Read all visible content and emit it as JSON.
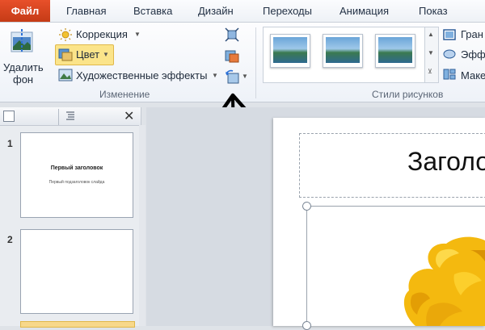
{
  "ribbon_tabs": {
    "file": "Файл",
    "home": "Главная",
    "insert": "Вставка",
    "design": "Дизайн",
    "transitions": "Переходы",
    "animation": "Анимация",
    "slideshow": "Показ слайдо"
  },
  "adjust_group": {
    "remove_bg_line1": "Удалить",
    "remove_bg_line2": "фон",
    "corrections": "Коррекция",
    "color": "Цвет",
    "artistic_effects": "Художественные эффекты",
    "label": "Изменение"
  },
  "styles_group": {
    "label": "Стили рисунков",
    "border": "Гран",
    "effects": "Эфф",
    "layout": "Маке"
  },
  "slides": [
    {
      "number": "1",
      "title": "Первый заголовок",
      "subtitle": "Первый подзаголовок слайда"
    },
    {
      "number": "2"
    }
  ],
  "current_slide": {
    "title": "Заголо"
  },
  "colors": {
    "file_tab": "#d0451c",
    "accent_highlight": "#fbe48a"
  }
}
